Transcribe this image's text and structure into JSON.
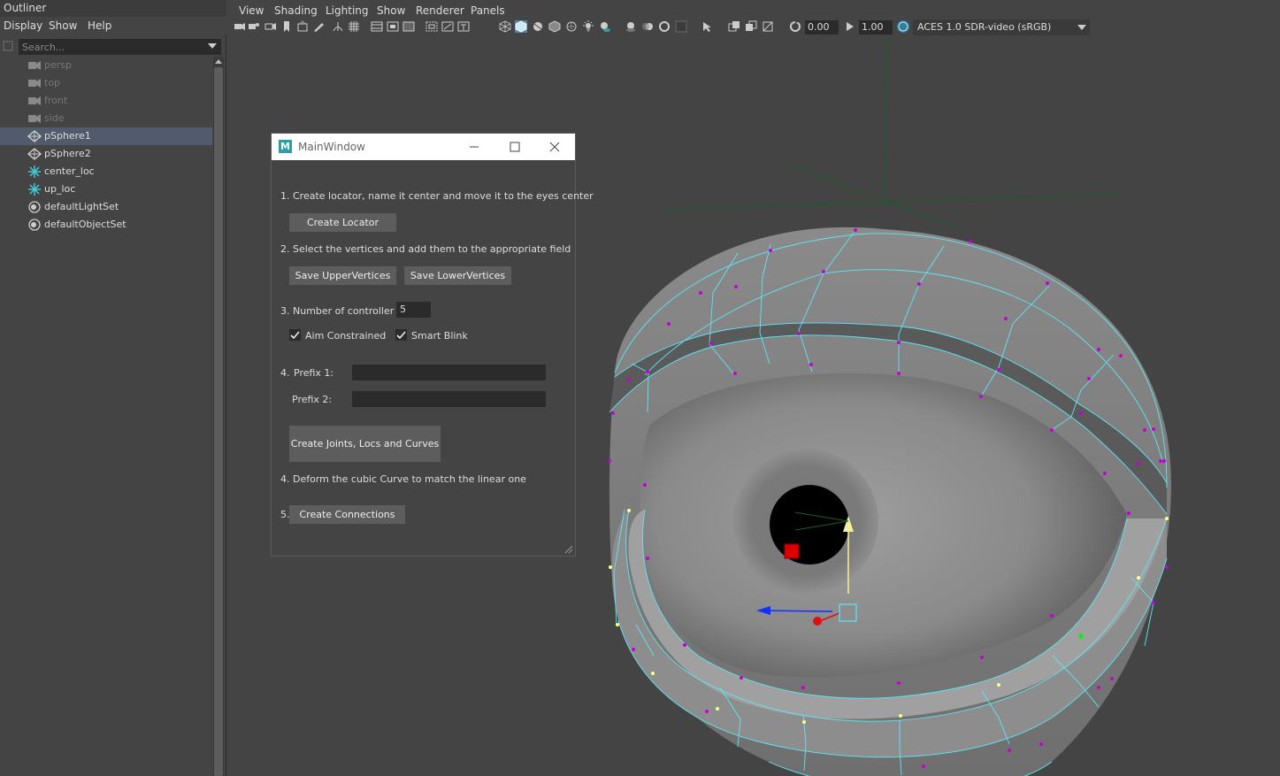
{
  "outliner": {
    "title": "Outliner",
    "menu": [
      "Display",
      "Show",
      "Help"
    ],
    "search_placeholder": "Search...",
    "items": [
      {
        "label": "persp",
        "icon": "camera-icon"
      },
      {
        "label": "top",
        "icon": "camera-icon"
      },
      {
        "label": "front",
        "icon": "camera-icon"
      },
      {
        "label": "side",
        "icon": "camera-icon"
      },
      {
        "label": "pSphere1",
        "icon": "mesh-icon"
      },
      {
        "label": "pSphere2",
        "icon": "mesh-icon"
      },
      {
        "label": "center_loc",
        "icon": "locator-icon"
      },
      {
        "label": "up_loc",
        "icon": "locator-icon"
      },
      {
        "label": "defaultLightSet",
        "icon": "set-icon"
      },
      {
        "label": "defaultObjectSet",
        "icon": "set-icon"
      }
    ],
    "selected_item": "pSphere1"
  },
  "viewport": {
    "menu": [
      "View",
      "Shading",
      "Lighting",
      "Show",
      "Renderer",
      "Panels"
    ],
    "exposure": "0.00",
    "gamma": "1.00",
    "color_space": "ACES 1.0 SDR-video (sRGB)"
  },
  "main_window": {
    "title": "MainWindow",
    "step1": "1. Create locator, name it center and move it to the eyes center",
    "create_locator": "Create Locator",
    "step2": "2. Select the vertices and add them to the appropriate field",
    "save_upper": "Save UpperVertices",
    "save_lower": "Save LowerVertices",
    "step3": "3. Number of controller",
    "num_controllers": "5",
    "aim_constrained": "Aim Constrained",
    "aim_checked": true,
    "smart_blink": "Smart Blink",
    "smart_blink_checked": true,
    "step4_num": "4.",
    "prefix1_label": "Prefix 1:",
    "prefix1_value": "",
    "prefix2_label": "Prefix 2:",
    "prefix2_value": "",
    "create_joints": "Create Joints, Locs and Curves",
    "step4b": "4. Deform the cubic Curve to match the linear one",
    "step5_num": "5.",
    "create_connections": "Create Connections"
  },
  "colors": {
    "selection_highlight": "#515b6b",
    "wireframe": "#5ee6f5",
    "vertex": "#c400d8",
    "locator_icon": "#43c9d6"
  }
}
